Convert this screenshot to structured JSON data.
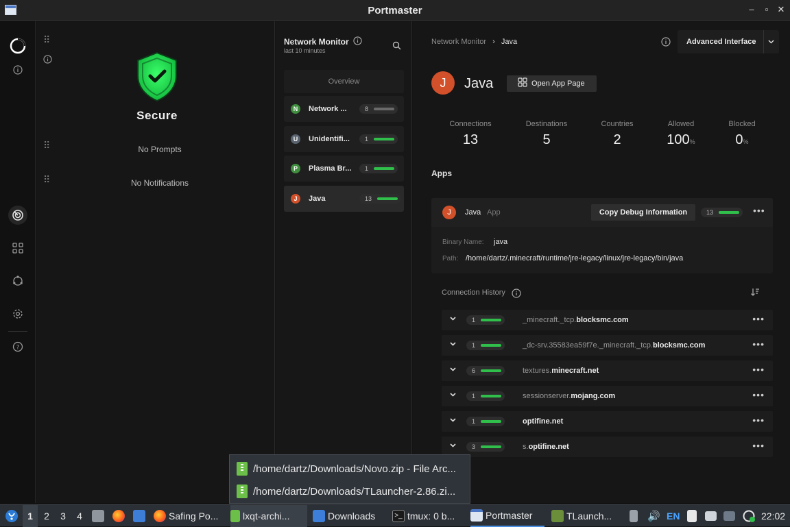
{
  "window": {
    "title": "Portmaster"
  },
  "status": {
    "title": "Secure",
    "prompts": "No Prompts",
    "notifications": "No Notifications"
  },
  "monitor": {
    "title": "Network Monitor",
    "subtitle": "last 10 minutes",
    "overview_label": "Overview",
    "items": [
      {
        "letter": "N",
        "label": "Network ...",
        "count": "8",
        "color": "#3f8f3f",
        "bar": "gray"
      },
      {
        "letter": "U",
        "label": "Unidentifi...",
        "count": "1",
        "color": "#5a6470",
        "bar": "green"
      },
      {
        "letter": "P",
        "label": "Plasma Br...",
        "count": "1",
        "color": "#3f8f3f",
        "bar": "green"
      },
      {
        "letter": "J",
        "label": "Java",
        "count": "13",
        "color": "#d2502a",
        "bar": "green"
      }
    ]
  },
  "detail": {
    "breadcrumb": {
      "parent": "Network Monitor",
      "sep": "›",
      "current": "Java"
    },
    "advanced_label": "Advanced Interface",
    "app_letter": "J",
    "app_name": "Java",
    "open_app_label": "Open App Page",
    "stats": [
      {
        "label": "Connections",
        "value": "13",
        "unit": ""
      },
      {
        "label": "Destinations",
        "value": "5",
        "unit": ""
      },
      {
        "label": "Countries",
        "value": "2",
        "unit": ""
      },
      {
        "label": "Allowed",
        "value": "100",
        "unit": "%"
      },
      {
        "label": "Blocked",
        "value": "0",
        "unit": "%"
      }
    ],
    "apps_heading": "Apps",
    "app_card": {
      "name": "Java",
      "tag": "App",
      "copy_debug_label": "Copy Debug Information",
      "count": "13",
      "binary_label": "Binary Name:",
      "binary_value": "java",
      "path_label": "Path:",
      "path_value": "/home/dartz/.minecraft/runtime/jre-legacy/linux/jre-legacy/bin/java"
    },
    "history_title": "Connection History",
    "connections": [
      {
        "count": "1",
        "prefix": "_minecraft._tcp.",
        "domain": "blocksmc.com"
      },
      {
        "count": "1",
        "prefix": "_dc-srv.35583ea59f7e._minecraft._tcp.",
        "domain": "blocksmc.com"
      },
      {
        "count": "6",
        "prefix": "textures.",
        "domain": "minecraft.net"
      },
      {
        "count": "1",
        "prefix": "sessionserver.",
        "domain": "mojang.com"
      },
      {
        "count": "1",
        "prefix": "",
        "domain": "optifine.net"
      },
      {
        "count": "3",
        "prefix": "s.",
        "domain": "optifine.net"
      }
    ]
  },
  "popup": {
    "items": [
      "/home/dartz/Downloads/Novo.zip - File Arc...",
      "/home/dartz/Downloads/TLauncher-2.86.zi..."
    ]
  },
  "taskbar": {
    "desktops": [
      "1",
      "2",
      "3",
      "4"
    ],
    "tasks": {
      "safing": "Safing Po...",
      "lxqt": "lxqt-archi...",
      "downloads": "Downloads",
      "tmux": "tmux: 0 b...",
      "portmaster": "Portmaster",
      "tlauncher": "TLaunch..."
    },
    "lang": "EN",
    "clock": "22:02"
  },
  "colors": {
    "accent_green": "#2fbf4a",
    "shield_green": "#1fd14a",
    "java_orange": "#d2502a"
  }
}
